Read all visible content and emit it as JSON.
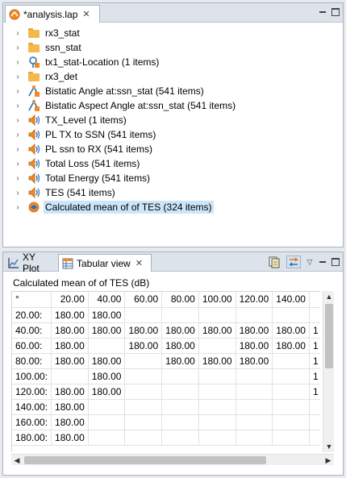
{
  "editor": {
    "tab_title": "*analysis.lap",
    "tree_items": [
      {
        "label": "rx3_stat",
        "icon": "folder-icon"
      },
      {
        "label": "ssn_stat",
        "icon": "folder-icon"
      },
      {
        "label": "tx1_stat-Location (1 items)",
        "icon": "location-dataset-icon"
      },
      {
        "label": "rx3_det",
        "icon": "folder-icon"
      },
      {
        "label": "Bistatic Angle at:ssn_stat (541 items)",
        "icon": "bistatic-dataset-icon"
      },
      {
        "label": "Bistatic Aspect Angle at:ssn_stat (541 items)",
        "icon": "bistatic-dataset-icon"
      },
      {
        "label": "TX_Level (1 items)",
        "icon": "acoustic-dataset-icon"
      },
      {
        "label": "PL TX to SSN (541 items)",
        "icon": "acoustic-dataset-icon"
      },
      {
        "label": "PL ssn to RX (541 items)",
        "icon": "acoustic-dataset-icon"
      },
      {
        "label": "Total Loss (541 items)",
        "icon": "acoustic-dataset-icon"
      },
      {
        "label": "Total Energy (541 items)",
        "icon": "acoustic-dataset-icon"
      },
      {
        "label": "TES (541 items)",
        "icon": "acoustic-dataset-icon"
      },
      {
        "label": "Calculated mean of of TES (324 items)",
        "icon": "calculated-dataset-icon"
      }
    ]
  },
  "view": {
    "tabs": [
      {
        "label": "XY Plot",
        "icon": "xy-plot-icon"
      },
      {
        "label": "Tabular view",
        "icon": "tabular-view-icon"
      }
    ],
    "table_title": "Calculated mean of of TES (dB)",
    "corner": "°",
    "columns": [
      "20.00",
      "40.00",
      "60.00",
      "80.00",
      "100.00",
      "120.00",
      "140.00",
      ""
    ],
    "rows": [
      {
        "label": "20.00:",
        "cells": [
          "180.00",
          "180.00",
          "",
          "",
          "",
          "",
          "",
          ""
        ]
      },
      {
        "label": "40.00:",
        "cells": [
          "180.00",
          "180.00",
          "180.00",
          "180.00",
          "180.00",
          "180.00",
          "180.00",
          "1"
        ]
      },
      {
        "label": "60.00:",
        "cells": [
          "180.00",
          "",
          "180.00",
          "180.00",
          "",
          "180.00",
          "180.00",
          "1"
        ]
      },
      {
        "label": "80.00:",
        "cells": [
          "180.00",
          "180.00",
          "",
          "180.00",
          "180.00",
          "180.00",
          "",
          "1"
        ]
      },
      {
        "label": "100.00:",
        "cells": [
          "",
          "180.00",
          "",
          "",
          "",
          "",
          "",
          "1"
        ]
      },
      {
        "label": "120.00:",
        "cells": [
          "180.00",
          "180.00",
          "",
          "",
          "",
          "",
          "",
          "1"
        ]
      },
      {
        "label": "140.00:",
        "cells": [
          "180.00",
          "",
          "",
          "",
          "",
          "",
          "",
          ""
        ]
      },
      {
        "label": "160.00:",
        "cells": [
          "180.00",
          "",
          "",
          "",
          "",
          "",
          "",
          ""
        ]
      },
      {
        "label": "180.00:",
        "cells": [
          "180.00",
          "",
          "",
          "",
          "",
          "",
          "",
          ""
        ]
      }
    ]
  },
  "colors": {
    "selection": "#cce5f8",
    "folder": "#f3b94d",
    "panel_border": "#a8b2bf",
    "tabbar": "#dde3eb"
  }
}
